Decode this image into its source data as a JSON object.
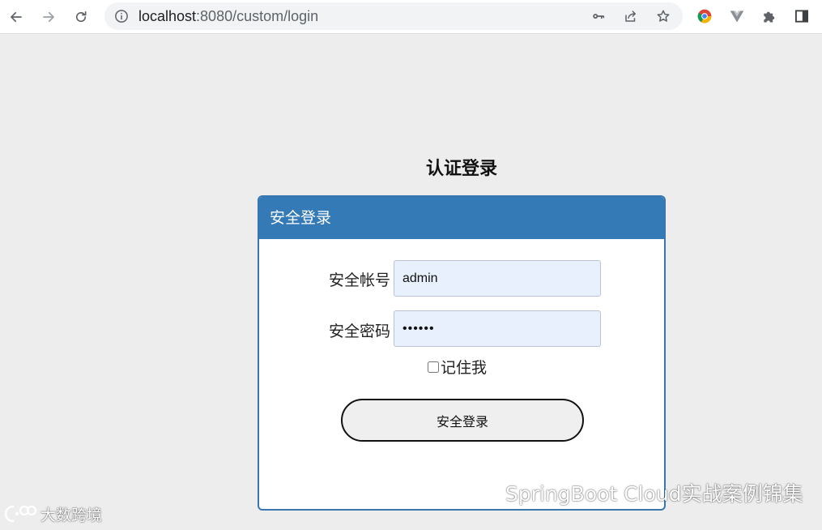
{
  "browser": {
    "url_host": "localhost",
    "url_rest": ":8080/custom/login",
    "icons": {
      "back": "arrow-left-icon",
      "forward": "arrow-right-icon",
      "reload": "reload-icon",
      "info": "info-icon",
      "key": "key-icon",
      "share": "share-icon",
      "bookmark": "star-icon",
      "extension_chrome": "chrome-logo-icon",
      "extension_vue": "vue-logo-icon",
      "extensions": "puzzle-icon",
      "side_panel": "side-panel-icon"
    }
  },
  "page": {
    "title": "认证登录"
  },
  "panel": {
    "header": "安全登录",
    "username_label": "安全帐号",
    "username_value": "admin",
    "password_label": "安全密码",
    "password_value": "••••••",
    "remember_label": "记住我",
    "submit_label": "安全登录"
  },
  "watermarks": {
    "right_text": "SpringBoot Cloud实战案例锦集",
    "left_text": "大数跨境"
  },
  "colors": {
    "panel_header": "#337ab7",
    "panel_border": "#3a77b1",
    "input_background": "#e8f0fe",
    "page_background": "#ededed"
  }
}
